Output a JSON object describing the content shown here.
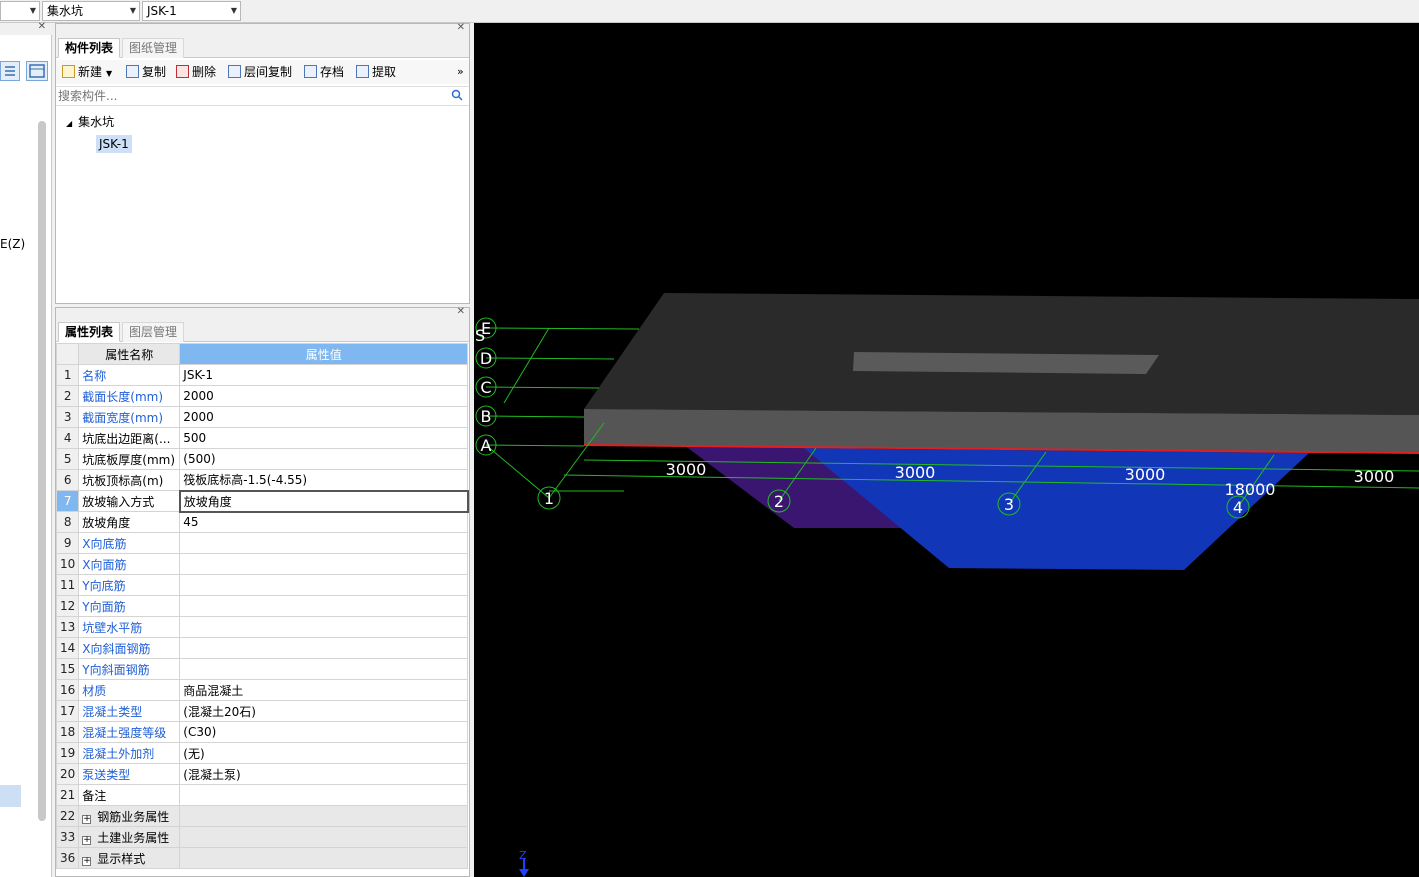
{
  "topbar": {
    "combo_blank": "",
    "combo_type": "集水坑",
    "combo_name": "JSK-1"
  },
  "leftpanel": {
    "partial_label": "E(Z)"
  },
  "component_panel": {
    "tab_active": "构件列表",
    "tab_inactive": "图纸管理",
    "toolbar": {
      "new": "新建",
      "copy": "复制",
      "delete": "删除",
      "floor_copy": "层间复制",
      "archive": "存档",
      "extract": "提取",
      "more": "»"
    },
    "search_placeholder": "搜索构件...",
    "tree": {
      "root": "集水坑",
      "child": "JSK-1"
    }
  },
  "property_panel": {
    "tab_active": "属性列表",
    "tab_inactive": "图层管理",
    "col_name": "属性名称",
    "col_value": "属性值",
    "rows": [
      {
        "num": "1",
        "name": "名称",
        "value": "JSK-1",
        "blue": true
      },
      {
        "num": "2",
        "name": "截面长度(mm)",
        "value": "2000",
        "blue": true
      },
      {
        "num": "3",
        "name": "截面宽度(mm)",
        "value": "2000",
        "blue": true
      },
      {
        "num": "4",
        "name": "坑底出边距离(...",
        "value": "500",
        "blue": false
      },
      {
        "num": "5",
        "name": "坑底板厚度(mm)",
        "value": "(500)",
        "blue": false
      },
      {
        "num": "6",
        "name": "坑板顶标高(m)",
        "value": "筏板底标高-1.5(-4.55)",
        "blue": false
      },
      {
        "num": "7",
        "name": "放坡输入方式",
        "value": "放坡角度",
        "blue": false
      },
      {
        "num": "8",
        "name": "放坡角度",
        "value": "45",
        "blue": false
      },
      {
        "num": "9",
        "name": "X向底筋",
        "value": "",
        "blue": true
      },
      {
        "num": "10",
        "name": "X向面筋",
        "value": "",
        "blue": true
      },
      {
        "num": "11",
        "name": "Y向底筋",
        "value": "",
        "blue": true
      },
      {
        "num": "12",
        "name": "Y向面筋",
        "value": "",
        "blue": true
      },
      {
        "num": "13",
        "name": "坑壁水平筋",
        "value": "",
        "blue": true
      },
      {
        "num": "14",
        "name": "X向斜面钢筋",
        "value": "",
        "blue": true
      },
      {
        "num": "15",
        "name": "Y向斜面钢筋",
        "value": "",
        "blue": true
      },
      {
        "num": "16",
        "name": "材质",
        "value": "商品混凝土",
        "blue": true
      },
      {
        "num": "17",
        "name": "混凝土类型",
        "value": "(混凝土20石)",
        "blue": true
      },
      {
        "num": "18",
        "name": "混凝土强度等级",
        "value": "(C30)",
        "blue": true
      },
      {
        "num": "19",
        "name": "混凝土外加剂",
        "value": "(无)",
        "blue": true
      },
      {
        "num": "20",
        "name": "泵送类型",
        "value": "(混凝土泵)",
        "blue": true
      },
      {
        "num": "21",
        "name": "备注",
        "value": "",
        "blue": false
      }
    ],
    "groups": [
      {
        "num": "22",
        "name": "钢筋业务属性"
      },
      {
        "num": "33",
        "name": "土建业务属性"
      },
      {
        "num": "36",
        "name": "显示样式"
      }
    ]
  },
  "viewport": {
    "axis_letters": [
      "E",
      "D",
      "C",
      "B",
      "A"
    ],
    "axis_numbers": [
      "1",
      "2",
      "3",
      "4"
    ],
    "dims": [
      "3000",
      "3000",
      "3000",
      "3000"
    ],
    "total_dim": "18000",
    "z_axis": "Z"
  },
  "colors": {
    "header_blue": "#7fb7f0",
    "slab": "#555555",
    "pit_blue": "#1236b8",
    "pit_purple": "#3a1670",
    "grid_green": "#22bb22"
  }
}
